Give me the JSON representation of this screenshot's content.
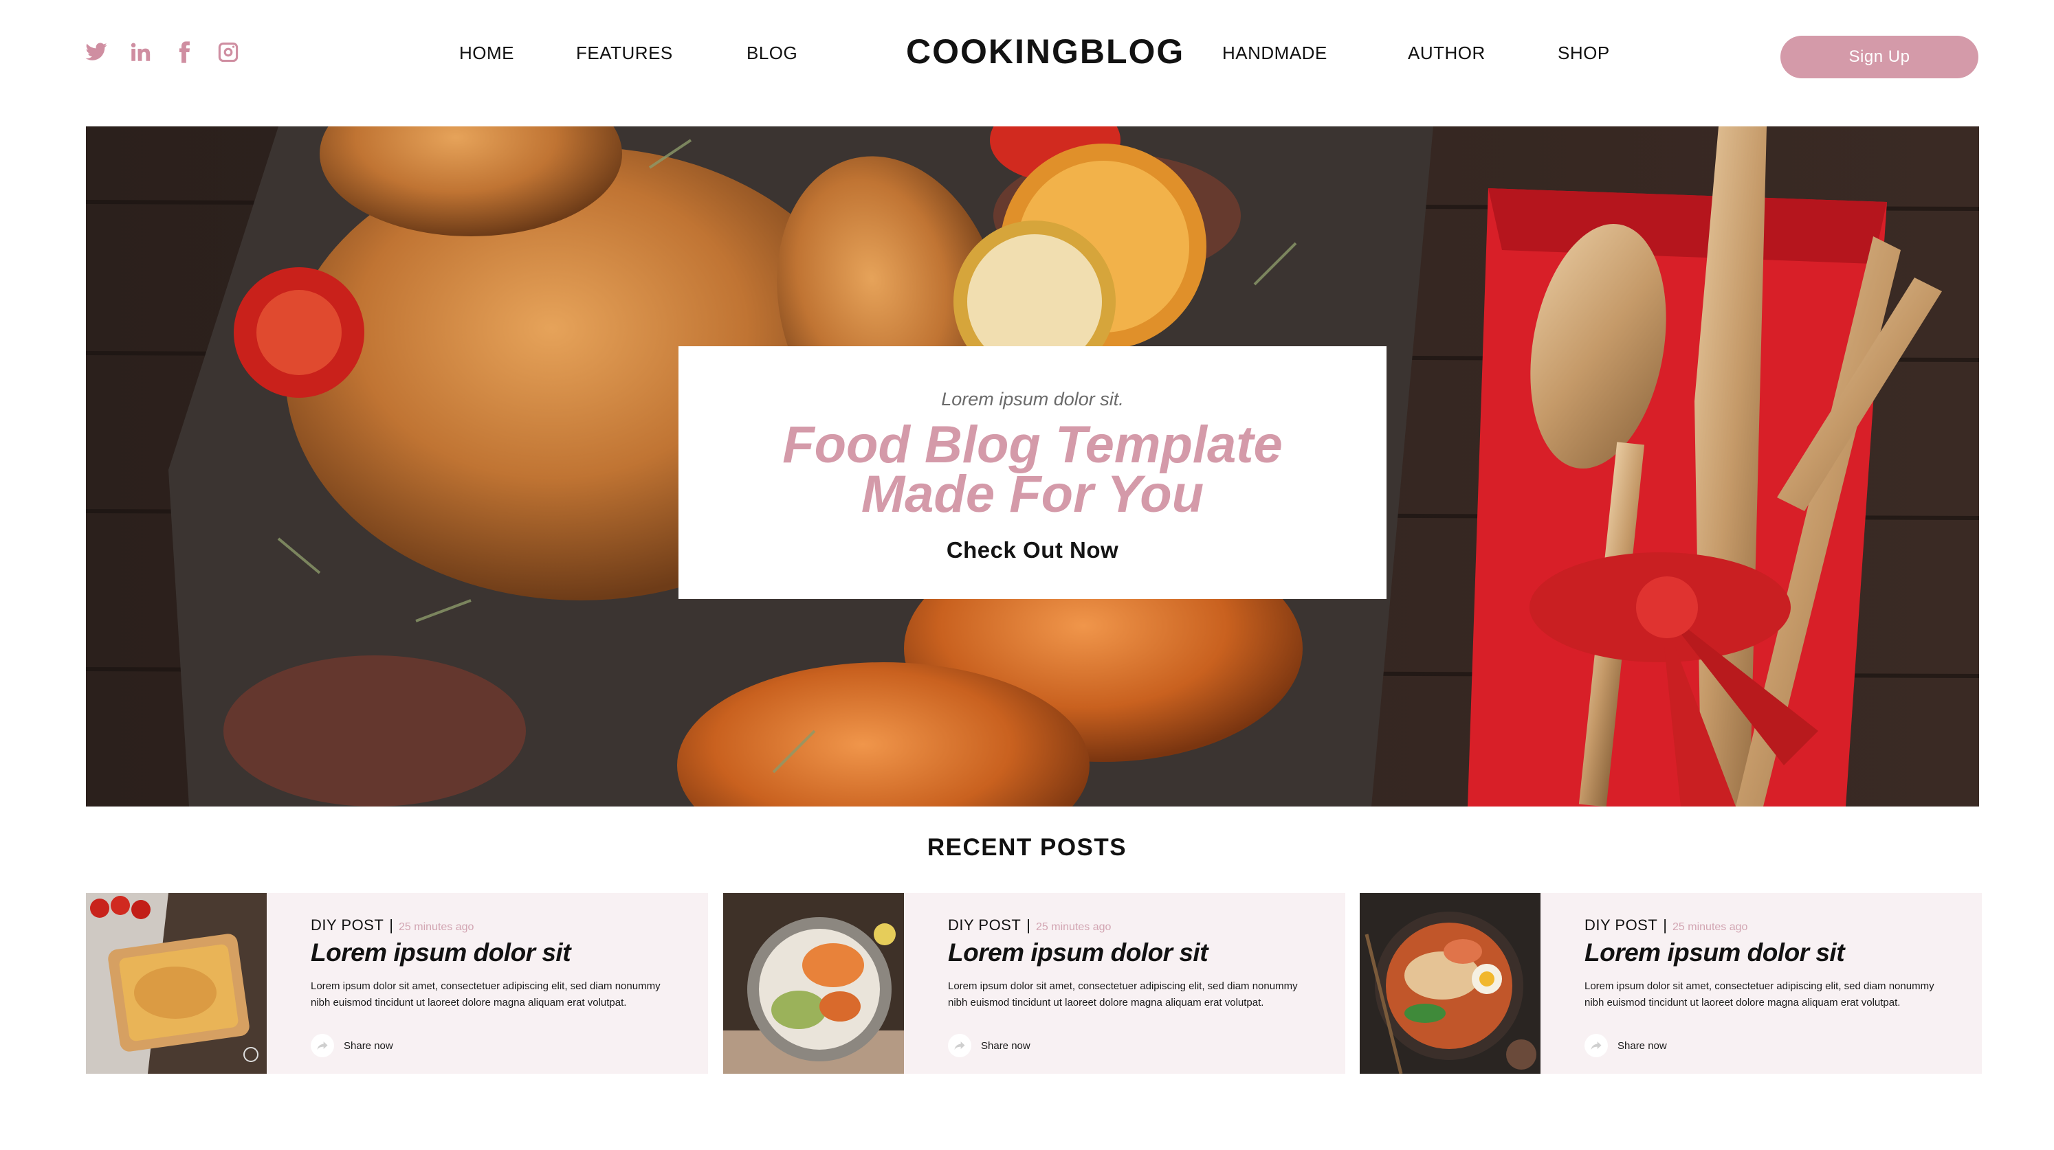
{
  "colors": {
    "accent": "#d49aa9",
    "card_bg": "#f8f1f3",
    "text": "#121212"
  },
  "header": {
    "socials": [
      {
        "icon": "twitter-icon"
      },
      {
        "icon": "linkedin-icon"
      },
      {
        "icon": "facebook-icon"
      },
      {
        "icon": "instagram-icon"
      }
    ],
    "nav_left": [
      "HOME",
      "FEATURES",
      "BLOG"
    ],
    "logo": "COOKINGBLOG",
    "nav_right": [
      "HANDMADE",
      "AUTHOR",
      "SHOP"
    ],
    "signup_label": "Sign Up"
  },
  "hero": {
    "eyebrow": "Lorem  ipsum dolor sit.",
    "title_line1": "Food Blog Template",
    "title_line2": "Made For You",
    "cta": "Check Out Now"
  },
  "recent": {
    "title": "RECENT POSTS",
    "posts": [
      {
        "category": "DIY POST",
        "separator": "|",
        "time": "25 minutes ago",
        "title": "Lorem  ipsum dolor sit",
        "body": "Lorem ipsum dolor sit amet, consectetuer adipiscing elit, sed diam nonummy nibh euismod tincidunt ut laoreet dolore magna aliquam erat volutpat.",
        "share": "Share now"
      },
      {
        "category": "DIY POST",
        "separator": "|",
        "time": "25 minutes ago",
        "title": "Lorem  ipsum dolor sit",
        "body": "Lorem ipsum dolor sit amet, consectetuer adipiscing elit, sed diam nonummy nibh euismod tincidunt ut laoreet dolore magna aliquam erat volutpat.",
        "share": "Share now"
      },
      {
        "category": "DIY POST",
        "separator": "|",
        "time": "25 minutes ago",
        "title": "Lorem  ipsum dolor sit",
        "body": "Lorem ipsum dolor sit amet, consectetuer adipiscing elit, sed diam nonummy nibh euismod tincidunt ut laoreet dolore magna aliquam erat volutpat.",
        "share": "Share now"
      }
    ]
  }
}
